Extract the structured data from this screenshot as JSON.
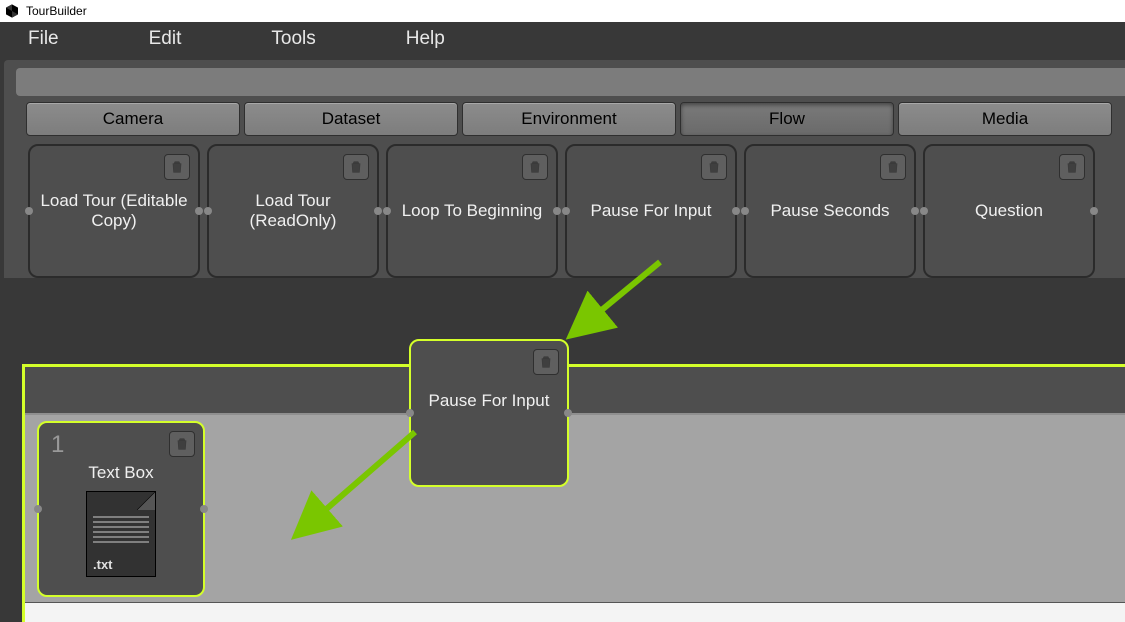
{
  "window": {
    "title": "TourBuilder"
  },
  "menubar": {
    "items": [
      "File",
      "Edit",
      "Tools",
      "Help"
    ]
  },
  "tabs": {
    "items": [
      "Camera",
      "Dataset",
      "Environment",
      "Flow",
      "Media"
    ],
    "active_index": 3
  },
  "palette_nodes": [
    {
      "label": "Load Tour (Editable Copy)"
    },
    {
      "label": "Load Tour (ReadOnly)"
    },
    {
      "label": "Loop To Beginning"
    },
    {
      "label": "Pause For Input"
    },
    {
      "label": "Pause Seconds"
    },
    {
      "label": "Question"
    }
  ],
  "canvas": {
    "dragged_node": {
      "label": "Pause For Input"
    },
    "textbox_node": {
      "slot": "1",
      "label": "Text Box",
      "ext": ".txt"
    }
  },
  "icons": {
    "trash": "trash-icon",
    "unity": "unity-icon"
  }
}
